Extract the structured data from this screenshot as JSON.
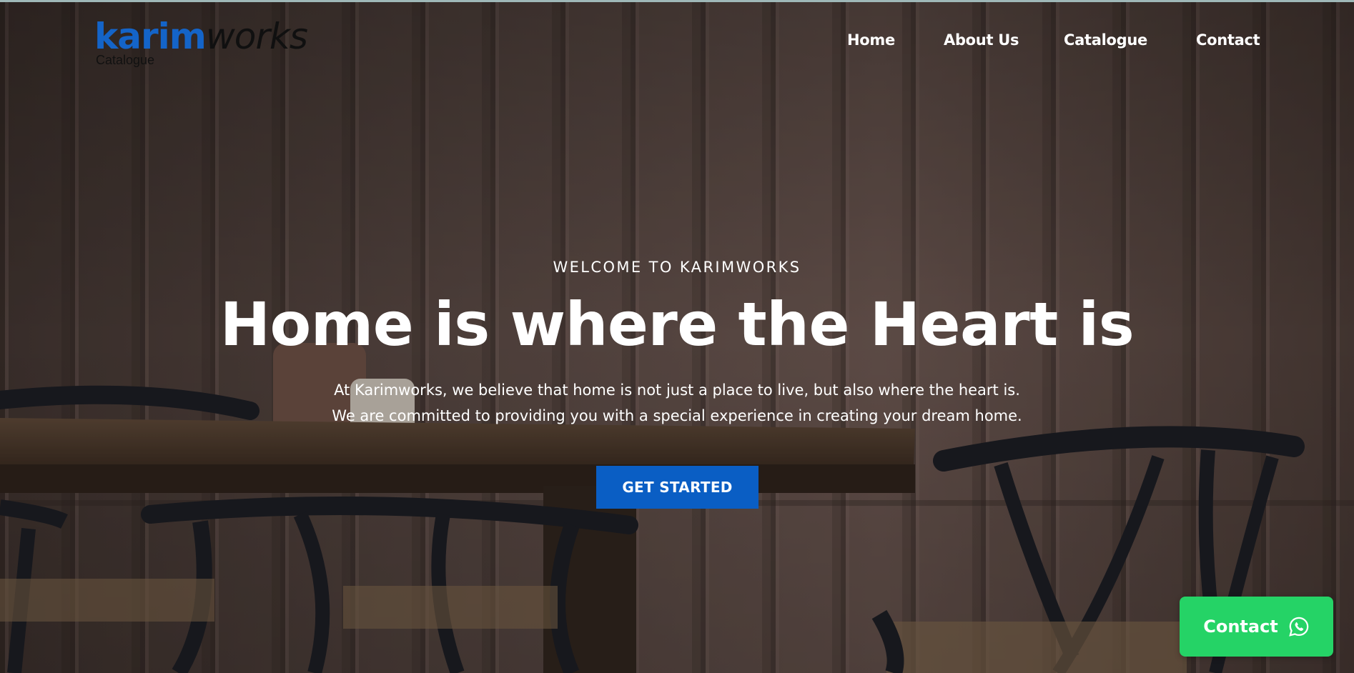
{
  "logo": {
    "brand_part1": "karim",
    "brand_part2": "works",
    "subtitle": "Catalogue"
  },
  "nav": {
    "items": [
      {
        "label": "Home"
      },
      {
        "label": "About Us"
      },
      {
        "label": "Catalogue"
      },
      {
        "label": "Contact"
      }
    ]
  },
  "hero": {
    "eyebrow": "WELCOME TO KARIMWORKS",
    "headline": "Home is where the Heart is",
    "description_line1": "At Karimworks, we believe that home is not just a place to live, but also where the heart is.",
    "description_line2": "We are committed to providing you with a special experience in creating your dream home.",
    "cta_label": "GET STARTED"
  },
  "floating_contact": {
    "label": "Contact",
    "icon": "whatsapp-icon"
  },
  "colors": {
    "brand_blue": "#1464c8",
    "cta_blue": "#0a5ec4",
    "whatsapp_green": "#25d366",
    "text_white": "#ffffff"
  }
}
